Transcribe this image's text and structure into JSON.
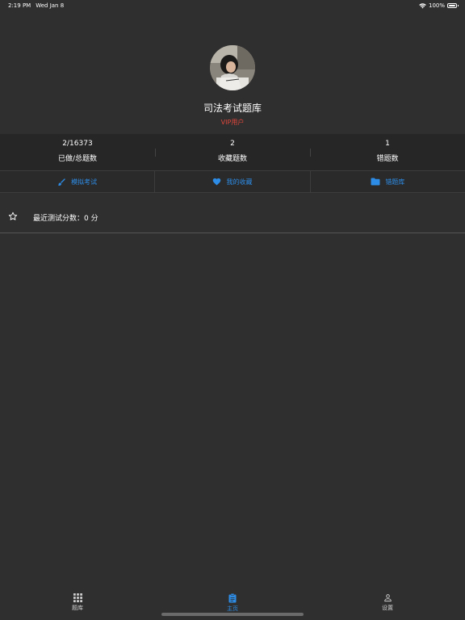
{
  "status": {
    "time": "2:19 PM",
    "date": "Wed Jan 8",
    "battery": "100%",
    "icons": [
      "wifi-icon",
      "battery-icon"
    ]
  },
  "profile": {
    "name": "司法考试题库",
    "badge": "VIP用户",
    "badge_color": "#e0473c"
  },
  "stats": [
    {
      "value": "2/16373",
      "label": "已做/总题数"
    },
    {
      "value": "2",
      "label": "收藏题数"
    },
    {
      "value": "1",
      "label": "错题数"
    }
  ],
  "actions": [
    {
      "label": "模拟考试",
      "icon": "brush-icon"
    },
    {
      "label": "我的收藏",
      "icon": "heart-icon"
    },
    {
      "label": "错题库",
      "icon": "folder-icon"
    }
  ],
  "recent": {
    "text": "最近测试分数：0 分",
    "icon": "star-icon"
  },
  "tabbar": [
    {
      "label": "题库",
      "icon": "grid-icon",
      "active": false
    },
    {
      "label": "主页",
      "icon": "clipboard-icon",
      "active": true
    },
    {
      "label": "设置",
      "icon": "person-icon",
      "active": false
    }
  ],
  "colors": {
    "accent": "#2d8ce6",
    "background": "#2f2f2f"
  }
}
